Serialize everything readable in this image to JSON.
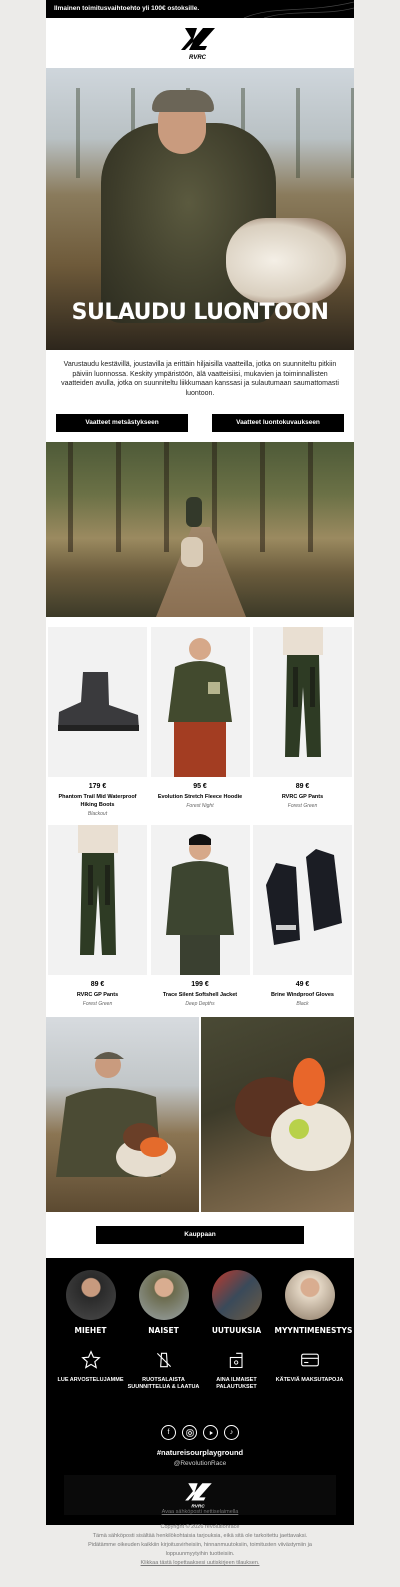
{
  "topbar": {
    "text": "Ilmainen toimitusvaihtoehto yli 100€ ostoksille."
  },
  "brand": {
    "name": "RVRC",
    "color": "#000000"
  },
  "hero": {
    "headline": "SULAUDU LUONTOON"
  },
  "intro": {
    "text": "Varustaudu kestävillä, joustavilla ja erittäin hiljaisilla vaatteilla, jotka on suunniteltu pitkiin päiviin luonnossa. Keskity ympäristöön, älä vaatteisiisi, mukavien ja toiminnallisten vaatteiden avulla, jotka on suunniteltu liikkumaan kanssasi ja sulautumaan saumattomasti luontoon."
  },
  "buttons": {
    "hunting": "Vaatteet metsästykseen",
    "photo": "Vaatteet luontokuvaukseen",
    "shop": "Kauppaan"
  },
  "products": [
    {
      "price": "179 €",
      "name": "Phantom Trail Mid Waterproof Hiking Boots",
      "color": "Blackout",
      "icon": "boot-icon"
    },
    {
      "price": "95 €",
      "name": "Evolution Stretch Fleece Hoodie",
      "color": "Forest Night",
      "icon": "hoodie-icon"
    },
    {
      "price": "89 €",
      "name": "RVRC GP Pants",
      "color": "Forest Green",
      "icon": "pants-icon"
    },
    {
      "price": "89 €",
      "name": "RVRC GP Pants",
      "color": "Forest Green",
      "icon": "pants-icon"
    },
    {
      "price": "199 €",
      "name": "Trace Silent Softshell Jacket",
      "color": "Deep Depths",
      "icon": "jacket-icon"
    },
    {
      "price": "49 €",
      "name": "Brine Windproof Gloves",
      "color": "Black",
      "icon": "gloves-icon"
    }
  ],
  "categories": [
    {
      "label": "MIEHET"
    },
    {
      "label": "NAISET"
    },
    {
      "label": "UUTUUKSIA"
    },
    {
      "label": "MYYNTIMENESTYS"
    }
  ],
  "usps": [
    {
      "label": "LUE ARVOSTELUJAMME",
      "icon": "star-icon"
    },
    {
      "label": "RUOTSALAISTA SUUNNITTELUA & LAATUA",
      "icon": "no-plastic-icon"
    },
    {
      "label": "AINA ILMAISET PALAUTUKSET",
      "icon": "return-box-icon"
    },
    {
      "label": "KÄTEVIÄ MAKSUTAPOJA",
      "icon": "card-icon"
    }
  ],
  "social": {
    "hashtag": "#natureisourplayground",
    "handle": "@RevolutionRace",
    "icons": [
      "facebook-icon",
      "instagram-icon",
      "youtube-icon",
      "tiktok-icon"
    ]
  },
  "legal": {
    "browser_link": "Avaa sähköposti nettiselaimella",
    "copyright": "Copyright © 2026 revolutionrace",
    "line1": "Tämä sähköposti sisältää henkilökohtaisia tarjouksia, eikä sitä ole tarkoitettu jaettavaksi.",
    "line2": "Pidätämme oikeuden kaikkiin kirjoitusvirheisiin, hinnanmuutoksiin, toimitusten viivästymiin ja",
    "line3": "loppuunmyytyihin tuotteisiin.",
    "unsubscribe": "Klikkaa tästä lopettaaksesi uutiskirjeen tilauksen."
  }
}
